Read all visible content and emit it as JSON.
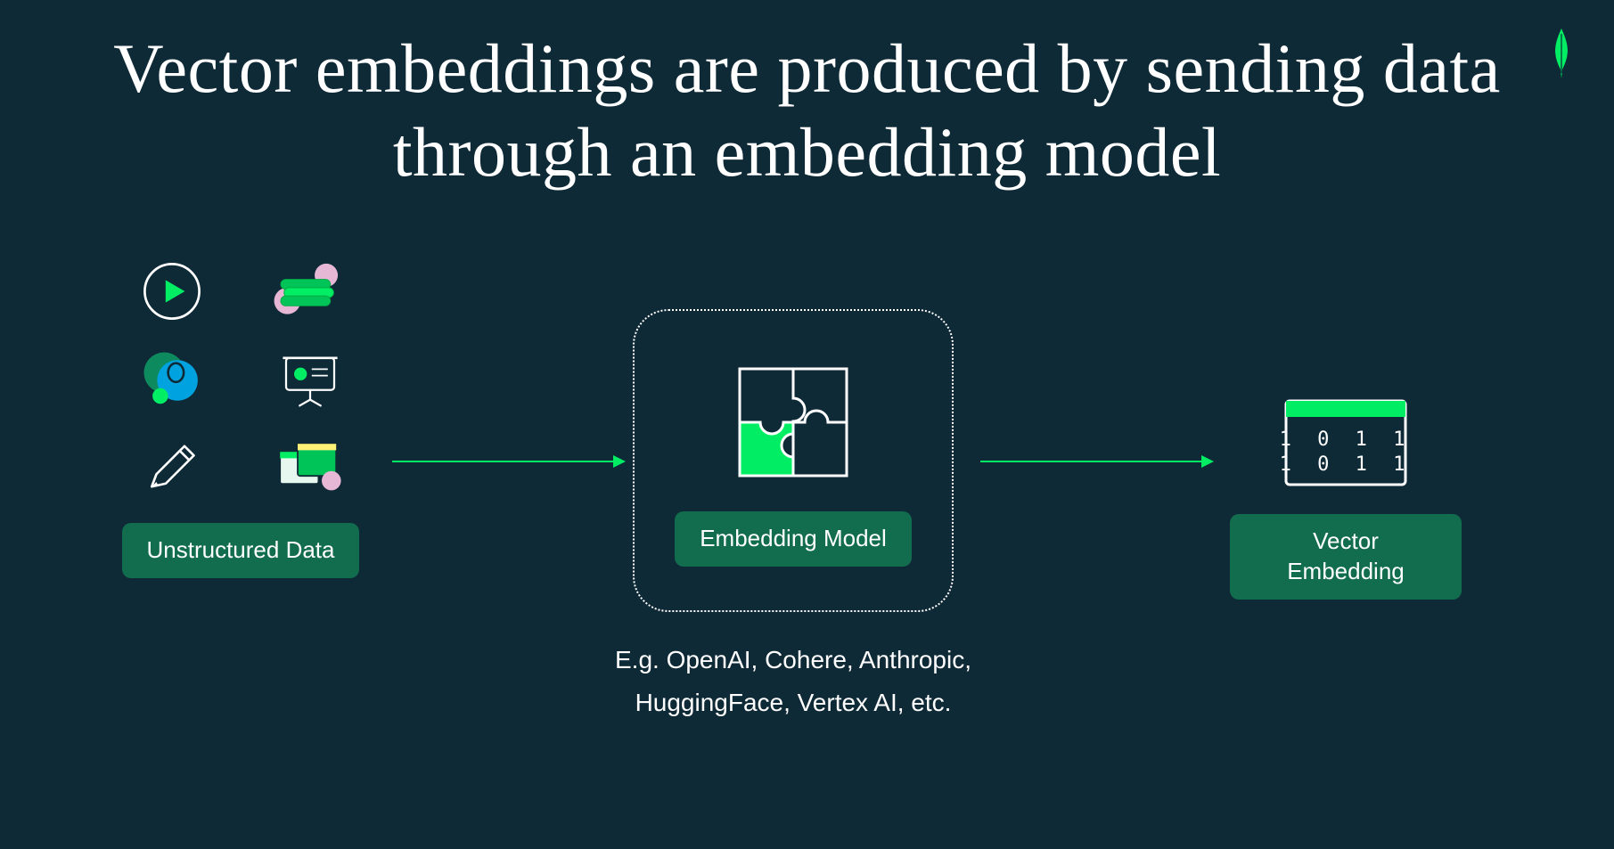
{
  "title": "Vector embeddings are produced by sending data through an embedding model",
  "labels": {
    "unstructured": "Unstructured Data",
    "embedding": "Embedding Model",
    "vector": "Vector Embedding"
  },
  "examples": {
    "line1": "E.g. OpenAI, Cohere, Anthropic,",
    "line2": "HuggingFace, Vertex AI, etc."
  },
  "colors": {
    "bg": "#0f2a37",
    "accent": "#00ed64",
    "labelbg": "#116d4d"
  },
  "icons": {
    "grid": [
      "play-icon",
      "money-icon",
      "chat-icon",
      "presentation-icon",
      "pencil-icon",
      "screens-icon"
    ],
    "leaf": "leaf-icon",
    "puzzle": "puzzle-icon",
    "matrix": "binary-matrix-icon"
  },
  "matrix_rows": [
    "1 0 1 1",
    "1 0 1 1"
  ]
}
